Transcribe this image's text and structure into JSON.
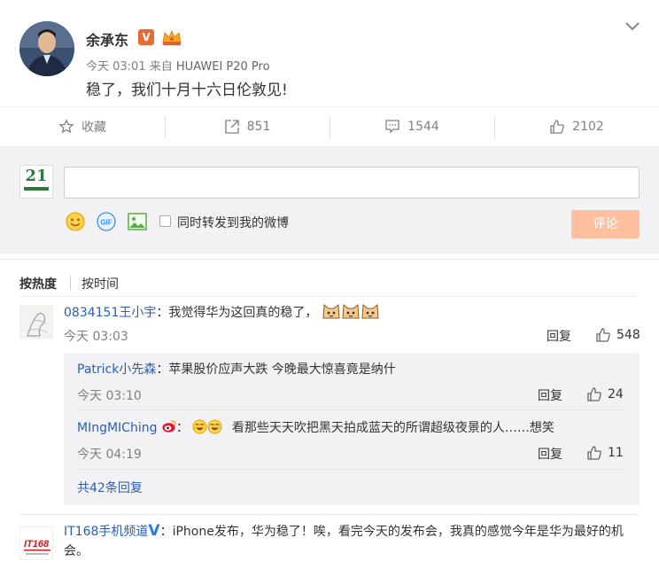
{
  "post": {
    "author": "余承东",
    "verified_badge": "V",
    "time": "今天 03:01",
    "source_prefix": "来自",
    "device": "HUAWEI P20 Pro",
    "text": "稳了，我们十月十六日伦敦见!"
  },
  "actions": {
    "favorite_label": "收藏",
    "forward_count": "851",
    "comment_count": "1544",
    "like_count": "2102"
  },
  "composer": {
    "input_value": "",
    "also_forward_label": "同时转发到我的微博",
    "submit_label": "评论",
    "avatar_text": "21"
  },
  "sort": {
    "by_hot": "按热度",
    "by_time": "按时间"
  },
  "comments": [
    {
      "user": "0834151王小宇",
      "text": "：我觉得华为这回真的稳了，",
      "time": "今天 03:03",
      "reply_label": "回复",
      "likes": "548"
    },
    {
      "user": "IT168手机频道",
      "badge": "V",
      "text": "：iPhone发布，华为稳了！唉，看完今天的发布会，我真的感觉今年是华为最好的机会。"
    }
  ],
  "sub_comments": [
    {
      "user": "Patrick小先森",
      "text": "：苹果股价应声大跌 今晚最大惊喜竟是纳什",
      "time": "今天 03:10",
      "reply_label": "回复",
      "likes": "24"
    },
    {
      "user": "MIngMIChing",
      "colon": "：",
      "text": "看那些天天吹把黑天拍成蓝天的所谓超级夜景的人……想笑",
      "time": "今天 04:19",
      "reply_label": "回复",
      "likes": "11"
    }
  ],
  "sub_more": "共42条回复",
  "colors": {
    "link_blue": "#2a5fb0",
    "accent_orange": "#eb7350",
    "submit_disabled": "#ffc09f",
    "panel_bg": "#f2f2f5"
  },
  "icons": [
    "chevron-down-icon",
    "star-icon",
    "share-icon",
    "comment-icon",
    "thumbs-up-icon",
    "smile-icon",
    "gif-icon",
    "image-icon"
  ]
}
